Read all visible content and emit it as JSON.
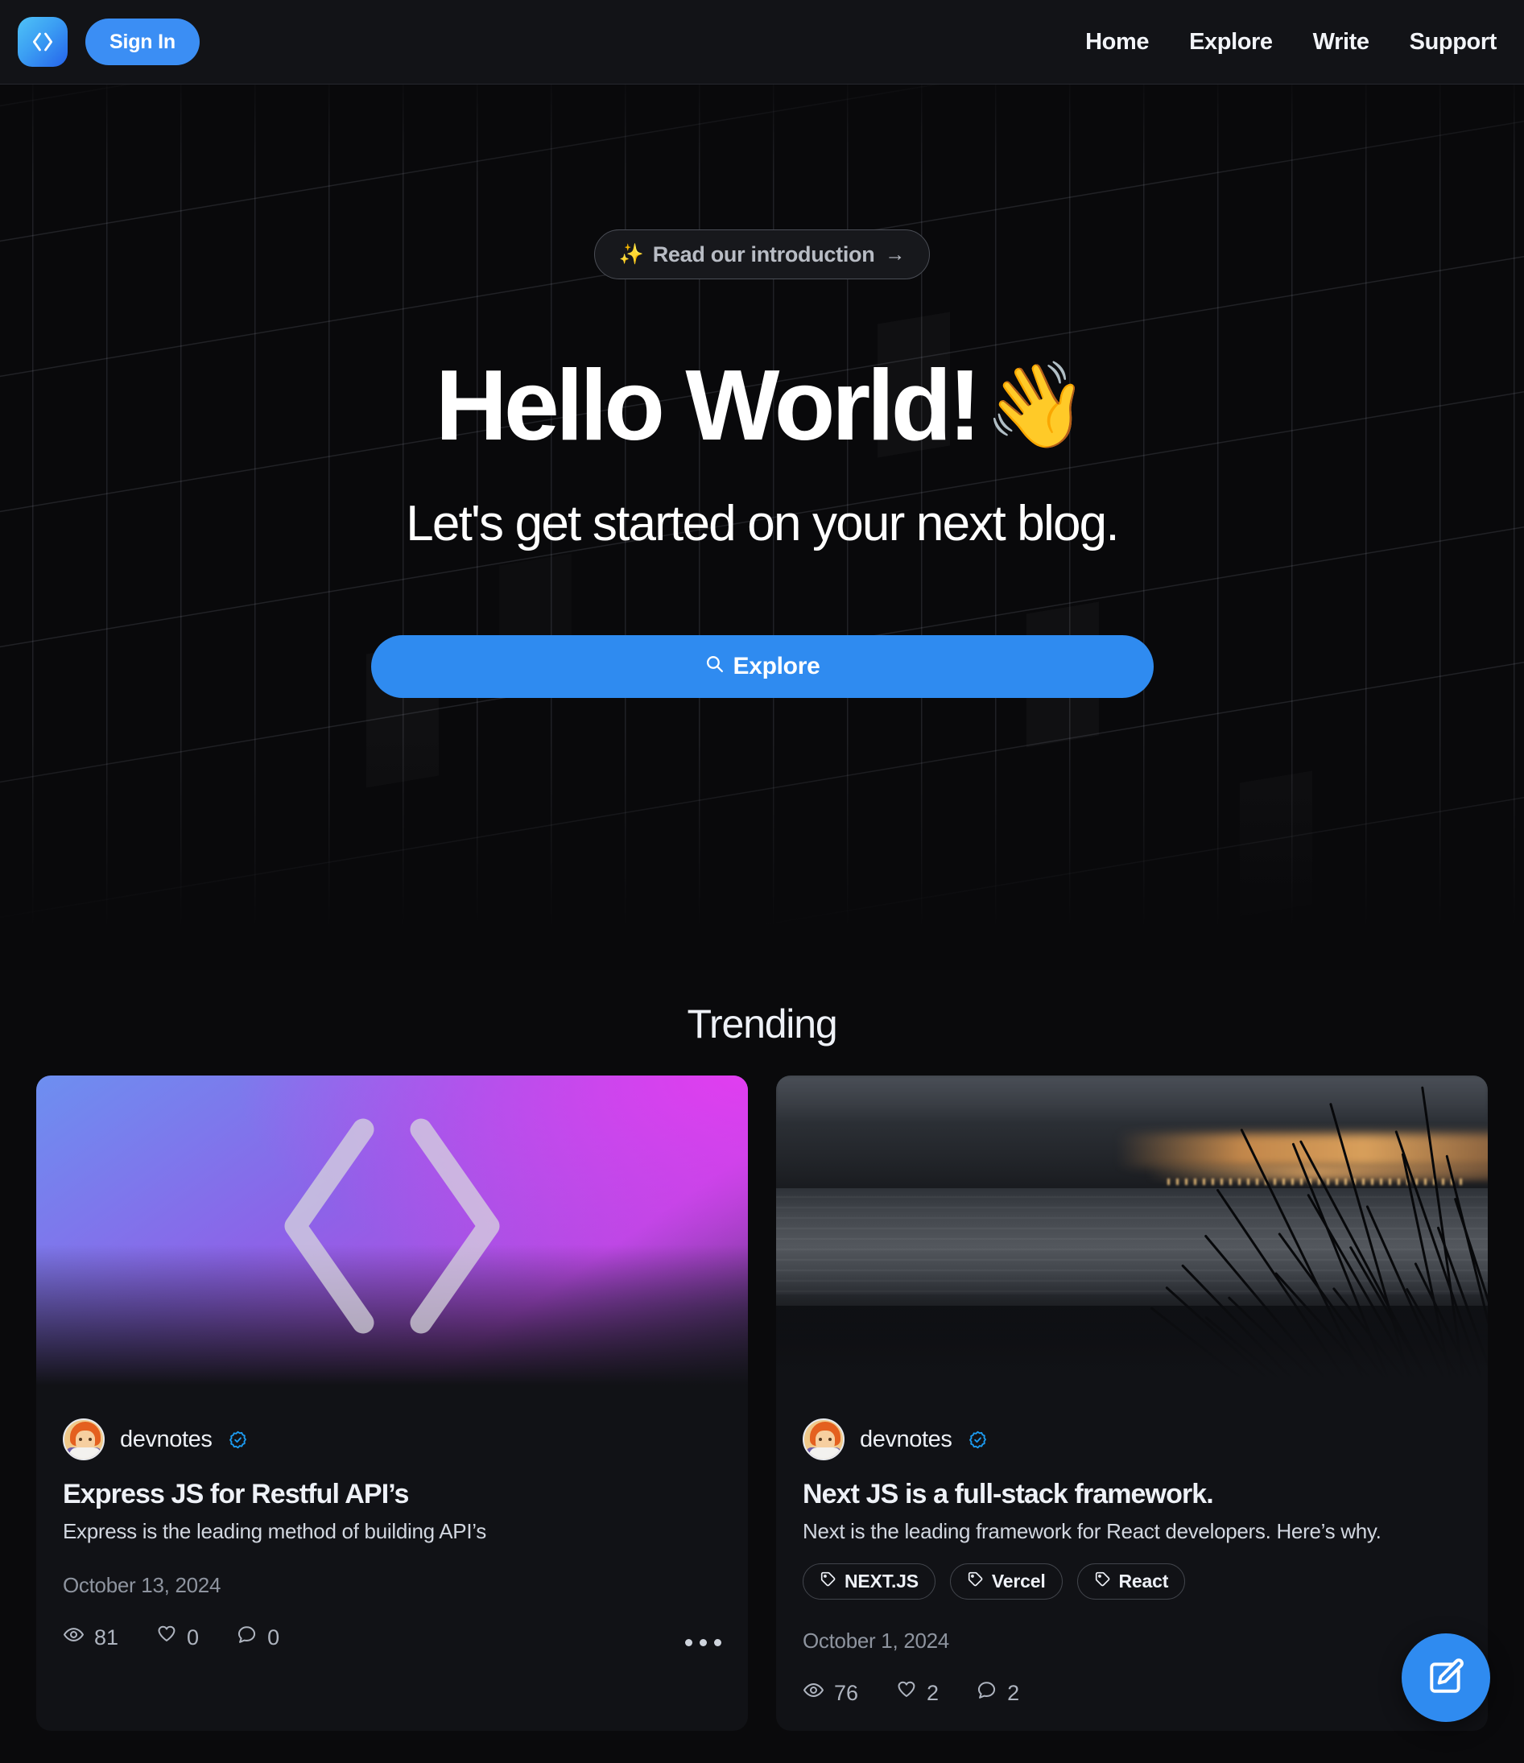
{
  "header": {
    "logo_icon": "code-brackets-icon",
    "signin_label": "Sign In",
    "nav": [
      {
        "label": "Home"
      },
      {
        "label": "Explore"
      },
      {
        "label": "Write"
      },
      {
        "label": "Support"
      }
    ]
  },
  "hero": {
    "intro_pill": {
      "sparkle": "✨",
      "label": "Read our introduction",
      "arrow": "→"
    },
    "title": "Hello World!",
    "title_emoji": "👋",
    "subtitle": "Let's get started on your next blog.",
    "cta_label": "Explore",
    "cta_icon": "search-icon",
    "cta_color": "#2f8bf0"
  },
  "trending": {
    "heading": "Trending",
    "cards": [
      {
        "cover_type": "code-gradient",
        "author": "devnotes",
        "verified": true,
        "title": "Express JS for Restful API’s",
        "description": "Express is the leading method of building API’s",
        "tags": [],
        "date": "October 13, 2024",
        "stats": {
          "views": "81",
          "likes": "0",
          "comments": "0"
        },
        "more_label": "..."
      },
      {
        "cover_type": "beach-photo",
        "author": "devnotes",
        "verified": true,
        "title": "Next JS is a full-stack framework.",
        "description": "Next is the leading framework for React developers. Here’s why.",
        "tags": [
          {
            "label": "NEXT.JS"
          },
          {
            "label": "Vercel"
          },
          {
            "label": "React"
          }
        ],
        "date": "October 1, 2024",
        "stats": {
          "views": "76",
          "likes": "2",
          "comments": "2"
        },
        "more_label": "..."
      }
    ]
  },
  "fab": {
    "icon": "compose-icon",
    "color": "#2f8bf0"
  }
}
